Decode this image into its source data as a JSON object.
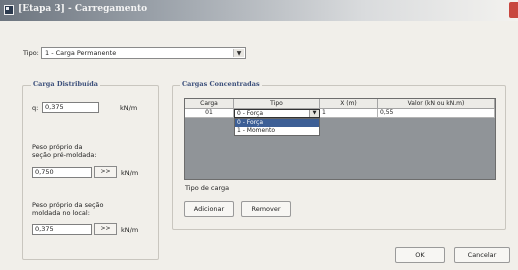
{
  "window": {
    "title": "[Etapa 3] - Carregamento"
  },
  "tipo": {
    "label": "Tipo:",
    "value": "1 - Carga Permanente"
  },
  "distribuida": {
    "title": "Carga Distribuída",
    "q_label": "q:",
    "q_value": "0,375",
    "q_unit": "kN/m",
    "peso_pre_label_1": "Peso próprio da",
    "peso_pre_label_2": "seção pré-moldada:",
    "peso_pre_value": "0,750",
    "peso_pre_btn": ">>",
    "peso_pre_unit": "kN/m",
    "peso_local_label_1": "Peso próprio da seção",
    "peso_local_label_2": "moldada no local:",
    "peso_local_value": "0,375",
    "peso_local_btn": ">>",
    "peso_local_unit": "kN/m"
  },
  "concentradas": {
    "title": "Cargas Concentradas",
    "headers": [
      "Carga",
      "Tipo",
      "X (m)",
      "Valor (kN ou kN.m)"
    ],
    "rows": [
      {
        "carga": "01",
        "tipo": "0 - Força",
        "x": "1",
        "valor": "0,55"
      }
    ],
    "dropdown_options": [
      "0 - Força",
      "1 - Momento"
    ],
    "tipo_de_carga_label": "Tipo de carga",
    "adicionar": "Adicionar",
    "remover": "Remover"
  },
  "footer": {
    "ok": "OK",
    "cancelar": "Cancelar"
  }
}
